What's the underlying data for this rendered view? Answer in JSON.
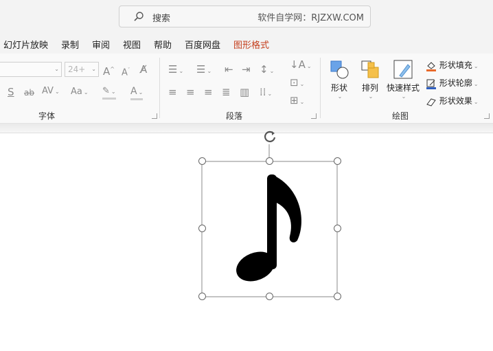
{
  "search": {
    "placeholder": "搜索",
    "watermark": "软件自学网：RJZXW.COM"
  },
  "tabs": [
    {
      "label": "幻灯片放映"
    },
    {
      "label": "录制"
    },
    {
      "label": "审阅"
    },
    {
      "label": "视图"
    },
    {
      "label": "帮助"
    },
    {
      "label": "百度网盘"
    },
    {
      "label": "图形格式",
      "active": true
    }
  ],
  "font_group": {
    "label": "字体",
    "font_size": "24+"
  },
  "paragraph_group": {
    "label": "段落"
  },
  "drawing_group": {
    "label": "绘图",
    "shape_label": "形状",
    "arrange_label": "排列",
    "quick_styles_label": "快速样式",
    "fill_label": "形状填充",
    "outline_label": "形状轮廓",
    "effects_label": "形状效果"
  },
  "colors": {
    "accent": "#c43e1c",
    "fill_bar": "#e8692a",
    "outline_bar": "#2f5fbf",
    "shape_fill": "#000000"
  },
  "icons": [
    "search-icon",
    "rotate-icon",
    "music-note-shape"
  ]
}
